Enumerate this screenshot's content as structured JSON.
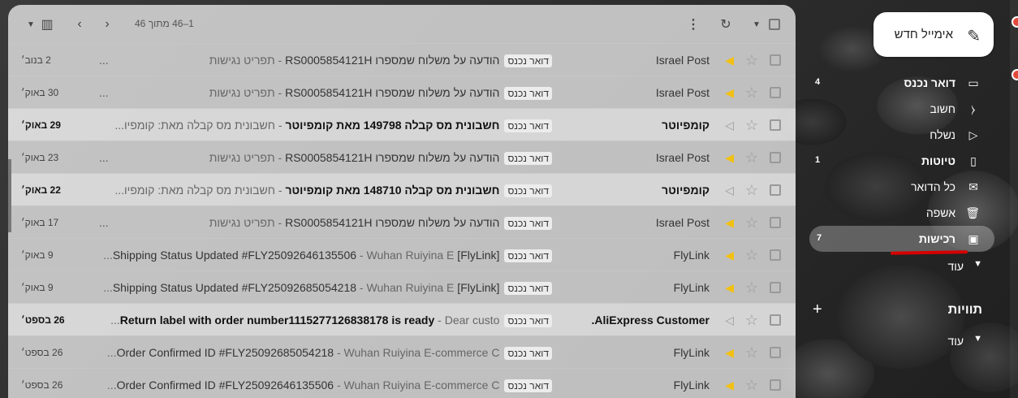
{
  "toolbar": {
    "range": "1–46 מתוך 46",
    "check_icon": "checkbox-icon",
    "refresh_icon": "refresh-icon",
    "more_icon": "more-vert-icon"
  },
  "compose": {
    "label": "אימייל חדש",
    "icon": "pencil-icon"
  },
  "nav": {
    "items": [
      {
        "label": "דואר נכנס",
        "count": "4",
        "icon": "inbox-icon",
        "strong": true
      },
      {
        "label": "חשוב",
        "count": "",
        "icon": "label-important-icon",
        "strong": false
      },
      {
        "label": "נשלח",
        "count": "",
        "icon": "send-icon",
        "strong": false
      },
      {
        "label": "טיוטות",
        "count": "1",
        "icon": "draft-icon",
        "strong": true
      },
      {
        "label": "כל הדואר",
        "count": "",
        "icon": "all-mail-icon",
        "strong": false
      },
      {
        "label": "אשפה",
        "count": "",
        "icon": "trash-icon",
        "strong": false
      },
      {
        "label": "רכישות",
        "count": "7",
        "icon": "shopping-bag-icon",
        "strong": true
      }
    ],
    "more_label": "עוד"
  },
  "labels_section": {
    "title": "תוויות",
    "more_label": "עוד"
  },
  "label_chip": "דואר נכנס",
  "emails": [
    {
      "sender": "Israel Post",
      "subject": "הודעה על משלוח שמספרו RS0005854121H",
      "snippet": "תפריט נגישות",
      "ellipsis": "...",
      "date": "2 בנוב׳",
      "bold": false,
      "important": true
    },
    {
      "sender": "Israel Post",
      "subject": "הודעה על משלוח שמספרו RS0005854121H",
      "snippet": "תפריט נגישות",
      "ellipsis": "...",
      "date": "30 באוק׳",
      "bold": false,
      "important": true
    },
    {
      "sender": "קומפיוטר",
      "subject": "חשבונית מס קבלה 149798 מאת קומפיוטר",
      "snippet": "חשבונית מס קבלה מאת: קומפיו...",
      "ellipsis": "",
      "date": "29 באוק׳",
      "bold": true,
      "important": false
    },
    {
      "sender": "Israel Post",
      "subject": "הודעה על משלוח שמספרו RS0005854121H",
      "snippet": "תפריט נגישות",
      "ellipsis": "...",
      "date": "23 באוק׳",
      "bold": false,
      "important": true
    },
    {
      "sender": "קומפיוטר",
      "subject": "חשבונית מס קבלה 148710 מאת קומפיוטר",
      "snippet": "חשבונית מס קבלה מאת: קומפיו...",
      "ellipsis": "",
      "date": "22 באוק׳",
      "bold": true,
      "important": false
    },
    {
      "sender": "Israel Post",
      "subject": "הודעה על משלוח שמספרו RS0005854121H",
      "snippet": "תפריט נגישות",
      "ellipsis": "...",
      "date": "17 באוק׳",
      "bold": false,
      "important": true
    },
    {
      "sender": "FlyLink",
      "subject": "[FlyLink] Shipping Status Updated #FLY25092646135506",
      "snippet": "Wuhan Ruiyina E...",
      "ellipsis": "",
      "date": "9 באוק׳",
      "bold": false,
      "important": true
    },
    {
      "sender": "FlyLink",
      "subject": "[FlyLink] Shipping Status Updated #FLY25092685054218",
      "snippet": "Wuhan Ruiyina E...",
      "ellipsis": "",
      "date": "9 באוק׳",
      "bold": false,
      "important": true
    },
    {
      "sender": "AliExpress Customer.",
      "subject": "Return label with order number1115277126838178 is ready",
      "snippet": "Dear custo...",
      "ellipsis": "",
      "date": "26 בספט׳",
      "bold": true,
      "important": false
    },
    {
      "sender": "FlyLink",
      "subject": "Order Confirmed ID #FLY25092685054218",
      "snippet": "Wuhan Ruiyina E-commerce C...",
      "ellipsis": "",
      "date": "26 בספט׳",
      "bold": false,
      "important": true
    },
    {
      "sender": "FlyLink",
      "subject": "Order Confirmed ID #FLY25092646135506",
      "snippet": "Wuhan Ruiyina E-commerce C...",
      "ellipsis": "",
      "date": "26 בספט׳",
      "bold": false,
      "important": true
    }
  ]
}
